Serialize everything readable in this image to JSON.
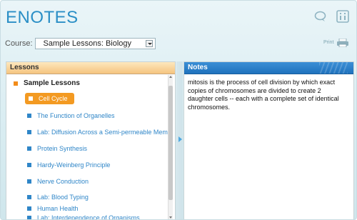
{
  "app": {
    "title": "ENOTES"
  },
  "toolbar": {
    "chat_icon": "chat-bubble-icon",
    "help_icon": "help-window-icon"
  },
  "course": {
    "label": "Course:",
    "selected": "Sample Lessons: Biology"
  },
  "print": {
    "label": "Print",
    "icon": "printer-icon"
  },
  "lessons": {
    "header": "Lessons",
    "root": "Sample Lessons",
    "items": [
      {
        "label": "Cell Cycle",
        "active": true
      },
      {
        "label": "The Function of Organelles"
      },
      {
        "label": "Lab: Diffusion Across a Semi-permeable Memb"
      },
      {
        "label": "Protein Synthesis"
      },
      {
        "label": "Hardy-Weinberg Principle"
      },
      {
        "label": "Nerve Conduction"
      },
      {
        "label": "Lab: Blood Typing"
      },
      {
        "label": "Human Health"
      },
      {
        "label": "Lab: Interdependence of Organisms"
      }
    ]
  },
  "notes": {
    "header": "Notes",
    "text": "mitosis is the process of cell division by which exact copies of chromosomes are divided to create 2 daughter cells -- each with a complete set of identical chromosomes."
  },
  "colors": {
    "accent_blue": "#2f86c8",
    "accent_orange": "#f39a22",
    "title_blue": "#2b8fc6"
  }
}
